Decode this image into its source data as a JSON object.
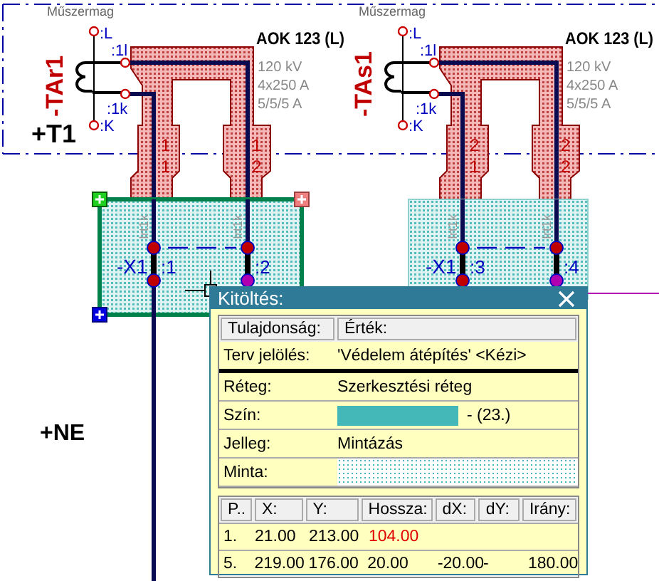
{
  "drawing": {
    "frame_labels": [
      "Műszermag",
      "Műszermag"
    ],
    "transformers": [
      {
        "designation": "-TAr1",
        "terminals": [
          ":L",
          ":1l",
          ":1k",
          ":K"
        ],
        "type": "AOK 123 (L)",
        "ratings": [
          "120 kV",
          "4x250 A",
          "5/5/5 A"
        ],
        "cores": [
          "1",
          "1",
          "1",
          "2"
        ],
        "location": "+T1"
      },
      {
        "designation": "-TAs1",
        "terminals": [
          ":L",
          ":1l",
          ":1k",
          ":K"
        ],
        "type": "AOK 123 (L)",
        "ratings": [
          "120 kV",
          "4x250 A",
          "5/5/5 A"
        ],
        "cores": [
          "2",
          "1",
          "2",
          "2"
        ]
      }
    ],
    "terminal_blocks": [
      {
        "label": "-X1",
        "selected": true,
        "terminals": [
          ":1",
          ":2"
        ],
        "wire_labels": [
          "Irt1k",
          "Irt1k"
        ]
      },
      {
        "label": "-X1",
        "selected": false,
        "terminals": [
          ":3",
          ":4"
        ],
        "wire_labels": [
          "Irt1k",
          "Irt1k"
        ]
      }
    ],
    "location_label": "+NE"
  },
  "dialog": {
    "title": "Kitöltés:",
    "property_headers": [
      "Tulajdonság:",
      "Érték:"
    ],
    "properties": [
      {
        "kind": "text",
        "label": "Terv jelölés:",
        "value": "'Védelem átépítés' <Kézi>"
      },
      {
        "kind": "text",
        "label": "Réteg:",
        "value": "Szerkesztési réteg"
      },
      {
        "kind": "color",
        "label": "Szín:",
        "color": "#44b8b8",
        "value": "- (23.)"
      },
      {
        "kind": "text",
        "label": "Jelleg:",
        "value": "Mintázás"
      },
      {
        "kind": "pattern",
        "label": "Minta:"
      }
    ],
    "point_columns": [
      "P..",
      "X:",
      "Y:",
      "Hossza:",
      "dX:",
      "dY:",
      "Irány:"
    ],
    "points": [
      {
        "cells": [
          "1.",
          "21.00",
          "213.00",
          "104.00"
        ],
        "length_flagged": true
      },
      {
        "cells": [
          "5.",
          "219.00",
          "176.00",
          "20.00",
          "-20.00",
          "-",
          "180.00"
        ],
        "length_flagged": false
      }
    ]
  }
}
